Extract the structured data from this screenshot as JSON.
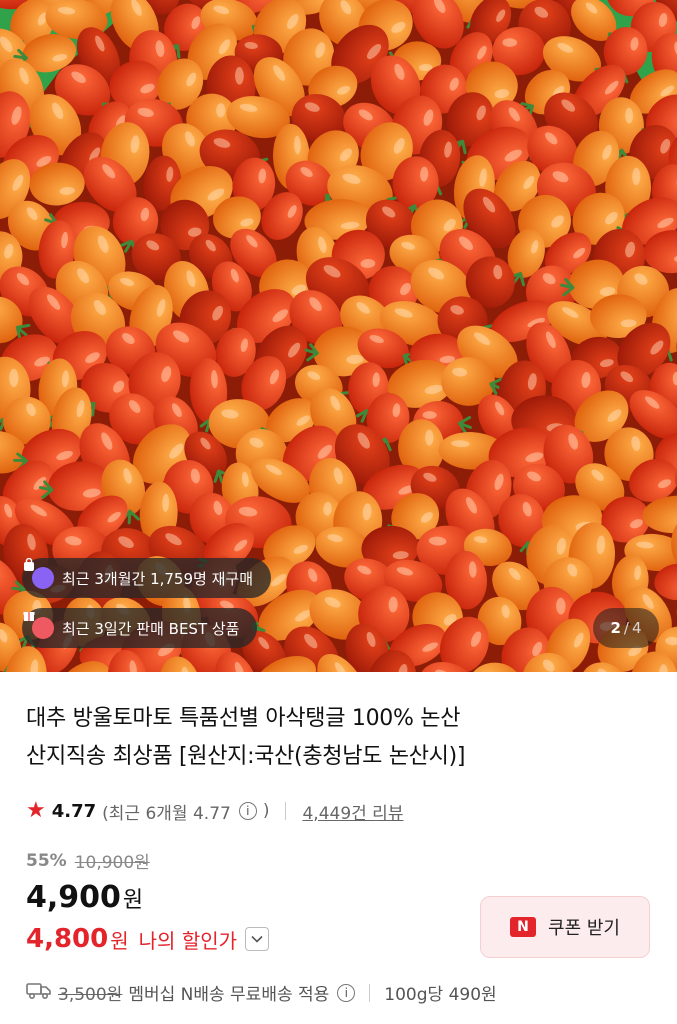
{
  "image": {
    "badges": [
      {
        "text": "최근 3개월간 1,759명 재구매",
        "icon": "shopping-bag-icon"
      },
      {
        "text": "최근 3일간 판매 BEST 상품",
        "icon": "gift-icon"
      }
    ],
    "pager": {
      "current": "2",
      "separator": "/",
      "total": "4"
    }
  },
  "product": {
    "title_line1": "대추 방울토마토 특품선별 아삭탱글 100% 논산",
    "title_line2": "산지직송 최상품 [원산지:국산(충청남도 논산시)]"
  },
  "rating": {
    "score": "4.77",
    "period_text": "(최근 6개월 4.77",
    "period_close": ")",
    "info_glyph": "i",
    "reviews": "4,449건 리뷰"
  },
  "pricing": {
    "discount_rate": "55%",
    "original_price": "10,900원",
    "price": "4,900",
    "price_unit": "원",
    "my_price": "4,800",
    "my_price_unit": "원",
    "my_price_label": "나의 할인가"
  },
  "coupon": {
    "badge": "N",
    "label": "쿠폰 받기"
  },
  "shipping": {
    "fee": "3,500원",
    "text": "멤버십 N배송 무료배송 적용",
    "info_glyph": "i",
    "unit_price": "100g당 490원"
  },
  "colors": {
    "accent_red": "#e3242b",
    "badge_bg": "#3a3a3a",
    "coupon_bg": "#fdeced",
    "crate_green": "#2fa24a"
  }
}
